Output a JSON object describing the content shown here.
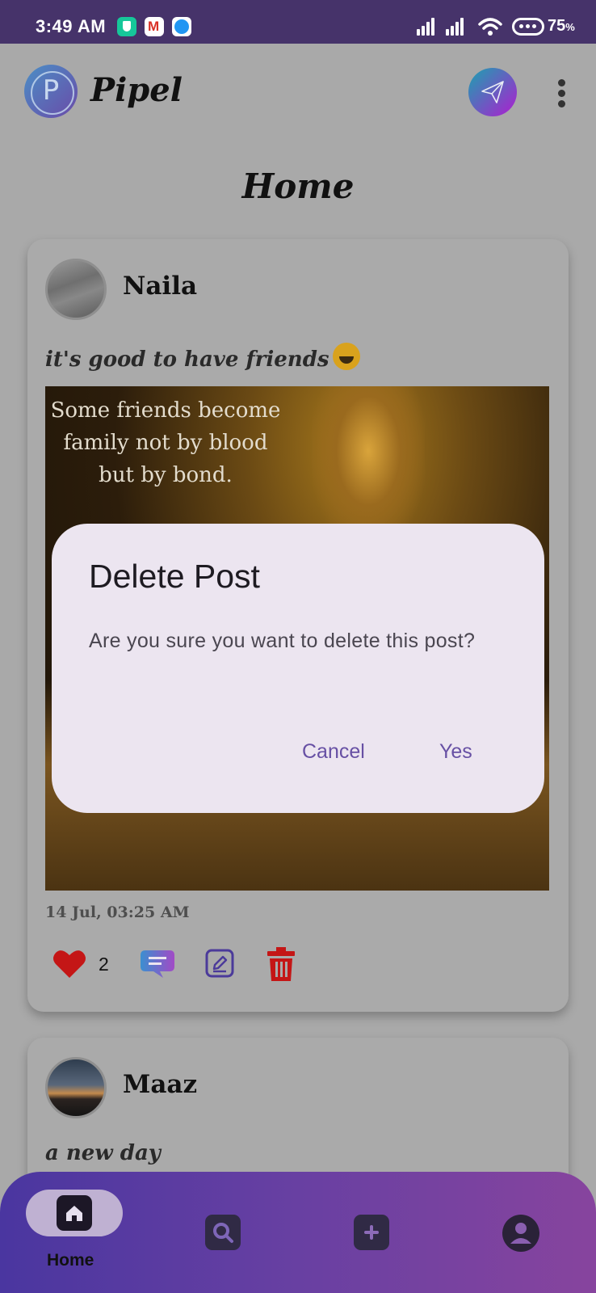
{
  "status_bar": {
    "time": "3:49 AM",
    "battery_percent": "75",
    "battery_unit": "%",
    "app_icons": [
      "shield-app-icon",
      "gmail-icon",
      "messenger-icon"
    ],
    "system_icons": [
      "signal-icon",
      "signal-icon",
      "wifi-icon",
      "battery-icon"
    ]
  },
  "app_bar": {
    "logo_letter": "P",
    "title": "Pipel"
  },
  "page": {
    "title": "Home"
  },
  "posts": [
    {
      "author": "Naila",
      "caption": "it's good to have friends",
      "image_text": [
        "Some friends become",
        "family not by blood",
        "but by bond."
      ],
      "date": "14 Jul, 03:25 AM",
      "likes": "2"
    },
    {
      "author": "Maaz",
      "caption": "a new day"
    }
  ],
  "dialog": {
    "title": "Delete Post",
    "message": "Are you sure you want to delete this post?",
    "cancel_label": "Cancel",
    "confirm_label": "Yes"
  },
  "bottom_nav": {
    "items": [
      {
        "label": "Home",
        "icon": "home-icon",
        "active": true
      },
      {
        "icon": "search-icon"
      },
      {
        "icon": "add-icon"
      },
      {
        "icon": "profile-icon"
      }
    ]
  },
  "colors": {
    "status_bar": "#46336a",
    "dialog_bg": "#ece5f0",
    "dialog_action": "#6750a4",
    "like": "#c41616",
    "delete": "#c41616",
    "nav_gradient_start": "#4a36a0",
    "nav_gradient_end": "#87449e"
  }
}
